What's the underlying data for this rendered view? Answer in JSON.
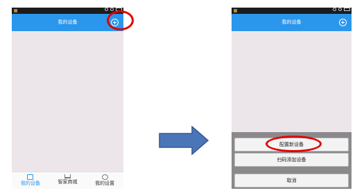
{
  "before": {
    "header": {
      "title": "我的设备"
    },
    "tabs": [
      {
        "label": "我的设备",
        "icon": "device-icon",
        "active": true
      },
      {
        "label": "智家商城",
        "icon": "cart-icon",
        "active": false
      },
      {
        "label": "我的设置",
        "icon": "gear-icon",
        "active": false
      }
    ]
  },
  "after": {
    "header": {
      "title": "我的设备"
    },
    "sheet": {
      "config_label": "配置新设备",
      "scan_label": "扫码添加设备",
      "cancel_label": "取消"
    }
  },
  "colors": {
    "header": "#2a96ec",
    "content": "#ece6ea",
    "highlight": "#e00000",
    "arrow": "#4a76b8"
  }
}
